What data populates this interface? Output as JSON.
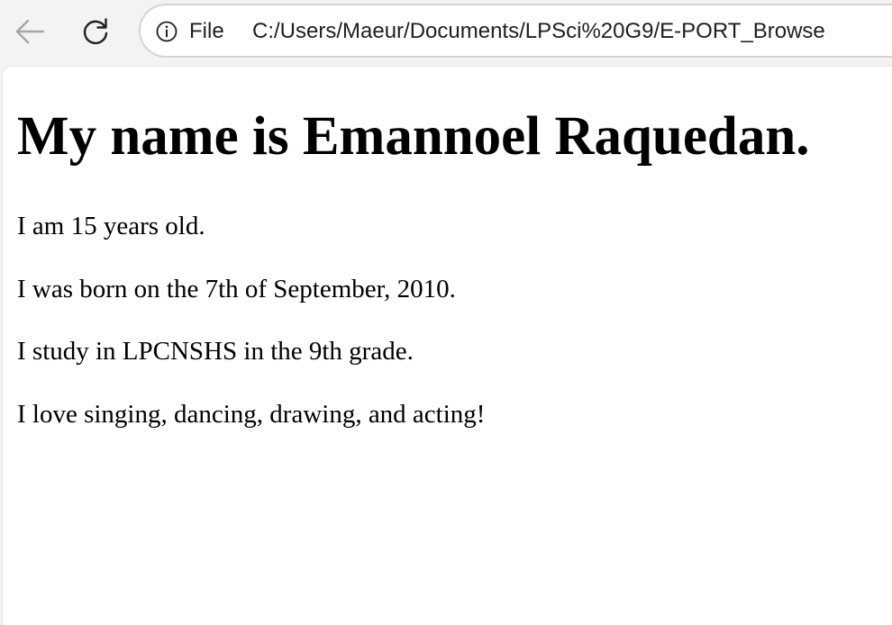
{
  "browser": {
    "back_icon": "arrow-left-icon",
    "reload_icon": "reload-icon",
    "info_icon": "info-icon",
    "scheme_label": "File",
    "url": "C:/Users/Maeur/Documents/LPSci%20G9/E-PORT_Browse"
  },
  "page": {
    "heading": "My name is Emannoel Raquedan.",
    "paragraphs": [
      "I am 15 years old.",
      "I was born on the 7th of September, 2010.",
      "I study in LPCNSHS in the 9th grade.",
      "I love singing, dancing, drawing, and acting!"
    ]
  }
}
